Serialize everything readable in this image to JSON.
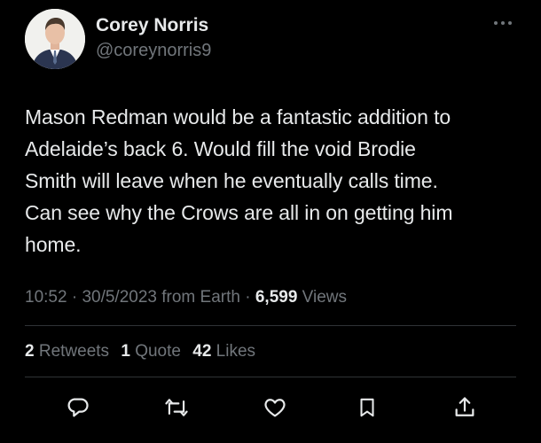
{
  "author": {
    "display_name": "Corey Norris",
    "handle": "@coreynorris9",
    "avatar_icon": "person-avatar"
  },
  "tweet": {
    "text_lines": [
      "Mason Redman would be a fantastic addition to",
      "Adelaide’s back 6. Would fill the void Brodie",
      "Smith will leave when he eventually calls time.",
      "Can see why the Crows are all in on getting him",
      "home."
    ]
  },
  "meta": {
    "time": "10:52",
    "sep1": " · ",
    "date": "30/5/2023",
    "source": " from Earth",
    "sep2": " · ",
    "views_count": "6,599",
    "views_label": " Views"
  },
  "stats": {
    "retweets_count": "2",
    "retweets_label": "Retweets",
    "quotes_count": "1",
    "quotes_label": "Quote",
    "likes_count": "42",
    "likes_label": "Likes"
  },
  "actions": [
    {
      "name": "reply",
      "icon": "reply-icon"
    },
    {
      "name": "retweet",
      "icon": "retweet-icon"
    },
    {
      "name": "like",
      "icon": "heart-icon"
    },
    {
      "name": "bookmark",
      "icon": "bookmark-icon"
    },
    {
      "name": "share",
      "icon": "share-icon"
    }
  ],
  "colors": {
    "background": "#000000",
    "primary_text": "#e7e9ea",
    "secondary_text": "#71767b",
    "divider": "#2f3336"
  }
}
